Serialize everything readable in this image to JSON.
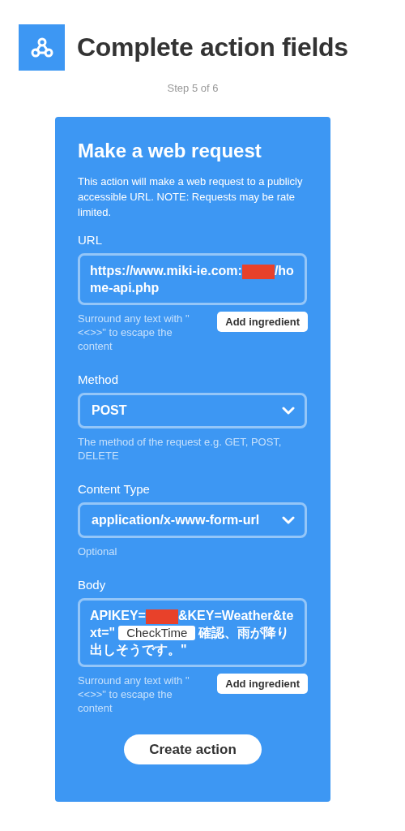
{
  "header": {
    "title": "Complete action fields",
    "step": "Step 5 of 6"
  },
  "card": {
    "title": "Make a web request",
    "description": "This action will make a web request to a publicly accessible URL. NOTE: Requests may be rate limited.",
    "fields": [
      {
        "kind": "text",
        "label": "URL",
        "segments": [
          {
            "kind": "text",
            "text": "https://www.miki-ie.com:"
          },
          {
            "kind": "redacted"
          },
          {
            "kind": "text",
            "text": "/home-api.php"
          }
        ],
        "hint": "Surround any text with \"<<>>\" to escape the content",
        "button": "Add ingredient"
      },
      {
        "kind": "select",
        "label": "Method",
        "value": "POST",
        "hint": "The method of the request e.g. GET, POST, DELETE"
      },
      {
        "kind": "select",
        "label": "Content Type",
        "value": "application/x-www-form-url",
        "hint": "Optional"
      },
      {
        "kind": "text",
        "label": "Body",
        "segments": [
          {
            "kind": "text",
            "text": "APIKEY="
          },
          {
            "kind": "redacted"
          },
          {
            "kind": "text",
            "text": "&KEY=Weather&text=\""
          },
          {
            "kind": "ingredient",
            "text": "CheckTime"
          },
          {
            "kind": "text",
            "text": "確認、雨が降り出しそうです。\""
          }
        ],
        "hint": "Surround any text with \"<<>>\" to escape the content",
        "button": "Add ingredient"
      }
    ],
    "submit": "Create action"
  }
}
